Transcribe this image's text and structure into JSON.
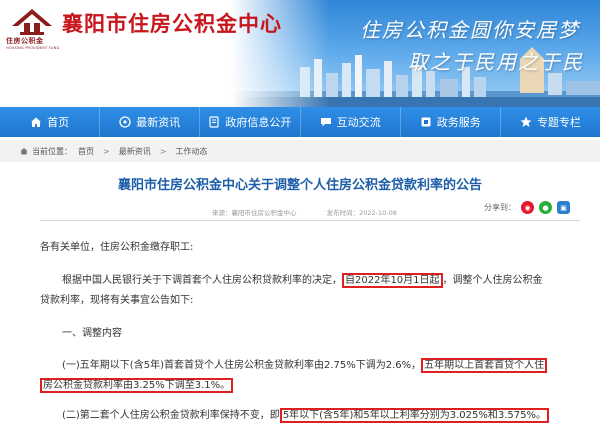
{
  "header": {
    "logo_cn": "住房公积金",
    "logo_en": "HOUSING PROVIDENT FUND",
    "title": "襄阳市住房公积金中心",
    "slogan_line1": "住房公积金圆你安居梦",
    "slogan_line2": "取之于民用之于民"
  },
  "nav": {
    "items": [
      {
        "label": "首页",
        "icon": "home-icon"
      },
      {
        "label": "最新资讯",
        "icon": "news-icon"
      },
      {
        "label": "政府信息公开",
        "icon": "info-icon"
      },
      {
        "label": "互动交流",
        "icon": "chat-icon"
      },
      {
        "label": "政务服务",
        "icon": "service-icon"
      },
      {
        "label": "专题专栏",
        "icon": "column-icon"
      }
    ]
  },
  "breadcrumb": {
    "prefix": "当前位置：",
    "items": [
      "首页",
      "最新资讯",
      "工作动态"
    ]
  },
  "article": {
    "title": "襄阳市住房公积金中心关于调整个人住房公积金贷款利率的公告",
    "source": "来源：襄阳市住房公积金中心",
    "date": "发布时间：2022-10-08",
    "share_label": "分享到：",
    "greeting": "各有关单位，住房公积金缴存职工:",
    "p1_a": "根据中国人民银行关于下调首套个人住房公积贷款利率的决定，",
    "p1_hl": "自2022年10月1日起",
    "p1_b": "，调整个人住房公积金",
    "p1_c": "贷款利率，现将有关事宜公告如下:",
    "section1": "一、调整内容",
    "p2_a": "(一)五年期以下(含5年)首套首贷个人住房公积金贷款利率由2.75%下调为2.6%，",
    "p2_hl1": "五年期以上首套首贷个人住",
    "p2_hl2": "房公积金贷款利率由3.25%下调至3.1%。",
    "p3_a": "(二)第二套个人住房公积金贷款利率保持不变，即",
    "p3_hl": "5年以下(含5年)和5年以上利率分别为3.025%和3.575%。"
  }
}
